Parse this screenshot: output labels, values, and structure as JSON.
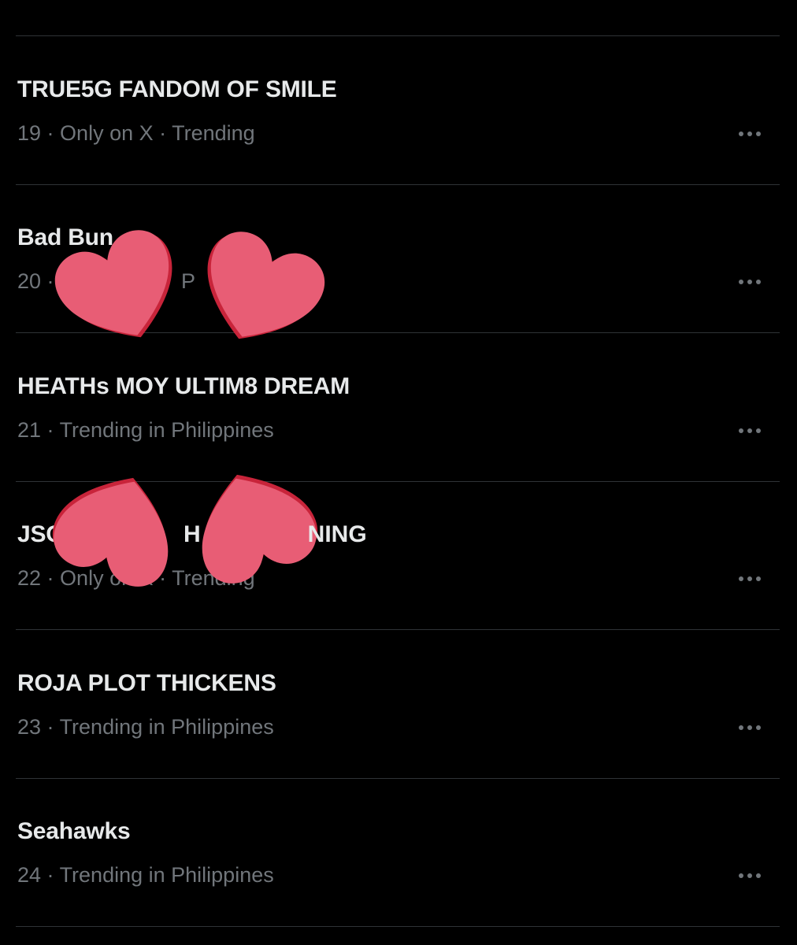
{
  "trends": [
    {
      "title": "TRUE5G FANDOM OF SMILE",
      "rank": "19",
      "meta": "Only on X · Trending",
      "more_icon": "more-horizontal-icon"
    },
    {
      "title": "Bad Bun",
      "rank": "20",
      "meta": "P",
      "more_icon": "more-horizontal-icon"
    },
    {
      "title": "HEATHs MOY ULTIM8 DREAM",
      "rank": "21",
      "meta": "Trending in Philippines",
      "more_icon": "more-horizontal-icon"
    },
    {
      "title": "JSO",
      "rank": "22",
      "meta": "Only on X · Trending",
      "more_icon": "more-horizontal-icon"
    },
    {
      "title": "ROJA PLOT THICKENS",
      "rank": "23",
      "meta": "Trending in Philippines",
      "more_icon": "more-horizontal-icon"
    },
    {
      "title": "Seahawks",
      "rank": "24",
      "meta": "Trending in Philippines",
      "more_icon": "more-horizontal-icon"
    }
  ],
  "colors": {
    "background": "#000000",
    "title_text": "#e7e9ea",
    "meta_text": "#71767b",
    "divider": "#2f3336",
    "heart_fill": "#e85d75",
    "heart_shadow": "#c8243a"
  }
}
